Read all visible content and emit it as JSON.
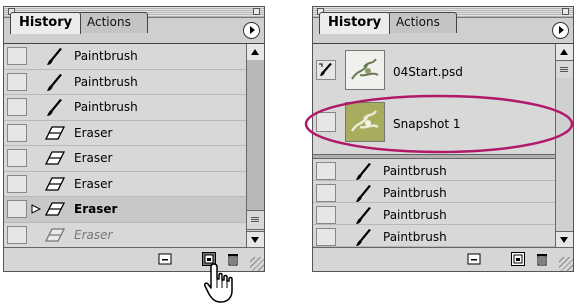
{
  "left_panel": {
    "tabs": [
      {
        "label": "History"
      },
      {
        "label": "Actions"
      }
    ],
    "rows": [
      {
        "label": "Paintbrush",
        "icon": "paintbrush-icon"
      },
      {
        "label": "Paintbrush",
        "icon": "paintbrush-icon"
      },
      {
        "label": "Paintbrush",
        "icon": "paintbrush-icon"
      },
      {
        "label": "Eraser",
        "icon": "eraser-icon"
      },
      {
        "label": "Eraser",
        "icon": "eraser-icon"
      },
      {
        "label": "Eraser",
        "icon": "eraser-icon"
      },
      {
        "label": "Eraser",
        "icon": "eraser-icon",
        "state": "current"
      },
      {
        "label": "Eraser",
        "icon": "eraser-icon",
        "state": "undone"
      }
    ],
    "bottom_buttons": [
      "new-document-from-state-icon",
      "new-snapshot-icon",
      "trash-icon"
    ]
  },
  "right_panel": {
    "tabs": [
      {
        "label": "History"
      },
      {
        "label": "Actions"
      }
    ],
    "snapshots": [
      {
        "label": "04Start.psd",
        "icon": "history-brush-icon"
      },
      {
        "label": "Snapshot 1"
      }
    ],
    "rows": [
      {
        "label": "Paintbrush",
        "icon": "paintbrush-icon"
      },
      {
        "label": "Paintbrush",
        "icon": "paintbrush-icon"
      },
      {
        "label": "Paintbrush",
        "icon": "paintbrush-icon"
      },
      {
        "label": "Paintbrush",
        "icon": "paintbrush-icon"
      }
    ],
    "bottom_buttons": [
      "new-document-from-state-icon",
      "new-snapshot-icon",
      "trash-icon"
    ]
  },
  "colors": {
    "highlight_ellipse": "#b0186a",
    "panel_bg": "#d8d8d8"
  }
}
